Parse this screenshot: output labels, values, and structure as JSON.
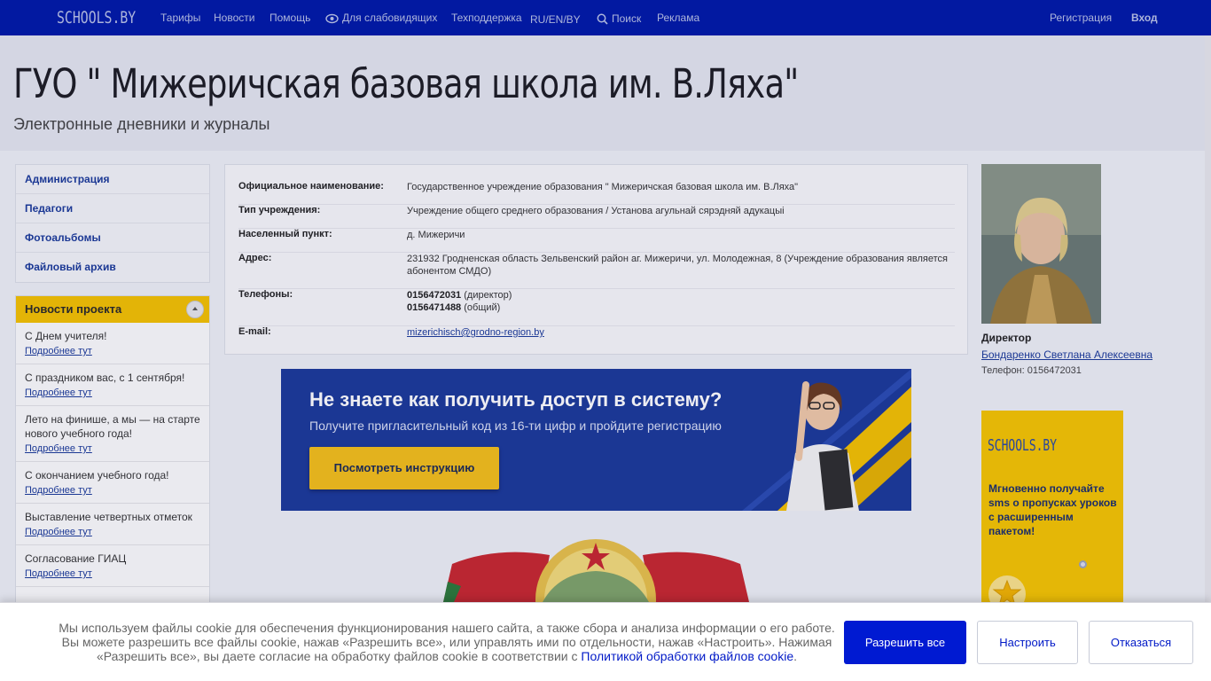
{
  "topbar": {
    "logo": "SCHOOLS.BY",
    "nav": {
      "tariffs": "Тарифы",
      "news": "Новости",
      "help": "Помощь",
      "accessibility": "Для слабовидящих",
      "support": "Техподдержка",
      "lang": "RU/EN/BY",
      "search": "Поиск",
      "ads": "Реклама"
    },
    "register": "Регистрация",
    "login": "Вход"
  },
  "header": {
    "title": "ГУО \" Мижеричская базовая школа им. В.Ляха\"",
    "subtitle": "Электронные дневники и журналы"
  },
  "sidebar": {
    "items": [
      {
        "label": "Администрация"
      },
      {
        "label": "Педагоги"
      },
      {
        "label": "Фотоальбомы"
      },
      {
        "label": "Файловый архив"
      }
    ]
  },
  "news": {
    "heading": "Новости проекта",
    "more_label": "Подробнее тут",
    "items": [
      {
        "title": "С Днем учителя!"
      },
      {
        "title": "С праздником вас, с 1 сентября!"
      },
      {
        "title": "Лето на финише, а мы — на старте нового учебного года!"
      },
      {
        "title": "С окончанием учебного года!"
      },
      {
        "title": "Выставление четвертных отметок"
      },
      {
        "title": "Согласование ГИАЦ"
      }
    ]
  },
  "info": {
    "official_name": {
      "label": "Официальное наименование:",
      "value": "Государственное учреждение образования \" Мижеричская базовая школа им. В.Ляха\""
    },
    "type": {
      "label": "Тип учреждения:",
      "value": "Учреждение общего среднего образования / Установа агульнай сярэдняй адукацыі"
    },
    "locality": {
      "label": "Населенный пункт:",
      "value": "д. Мижеричи"
    },
    "address": {
      "label": "Адрес:",
      "value": "231932 Гродненская область Зельвенский район аг. Мижеричи, ул. Молодежная, 8 (Учреждение образования является абонентом СМДО)"
    },
    "phones": {
      "label": "Телефоны:",
      "phone1": "0156472031",
      "phone1_note": "(директор)",
      "phone2": "0156471488",
      "phone2_note": "(общий)"
    },
    "email": {
      "label": "E-mail:",
      "value": "mizerichisch@grodno-region.by"
    }
  },
  "banner": {
    "title": "Не знаете как получить доступ в систему?",
    "subtitle": "Получите пригласительный код из 16-ти цифр и пройдите регистрацию",
    "button": "Посмотреть инструкцию"
  },
  "director": {
    "role": "Директор",
    "name": "Бондаренко Светлана Алексеевна",
    "phone": "Телефон: 0156472031"
  },
  "ad": {
    "logo": "SCHOOLS.BY",
    "text": "Мгновенно получайте sms о пропусках уроков с расширенным пакетом!"
  },
  "cookie": {
    "text": "Мы используем файлы cookie для обеспечения функционирования нашего сайта, а также сбора и анализа информации о его работе. Вы можете разрешить все файлы cookie, нажав «Разрешить все», или управлять ими по отдельности, нажав «Настроить». Нажимая «Разрешить все», вы даете согласие на обработку файлов cookie в соответствии с ",
    "link": "Политикой обработки файлов cookie",
    "tail": ".",
    "allow": "Разрешить все",
    "configure": "Настроить",
    "reject": "Отказаться"
  },
  "colors": {
    "topbar": "#001aa8",
    "accent_yellow": "#f5c200",
    "link_blue": "#1c3b9a",
    "primary_button": "#001ad2"
  }
}
